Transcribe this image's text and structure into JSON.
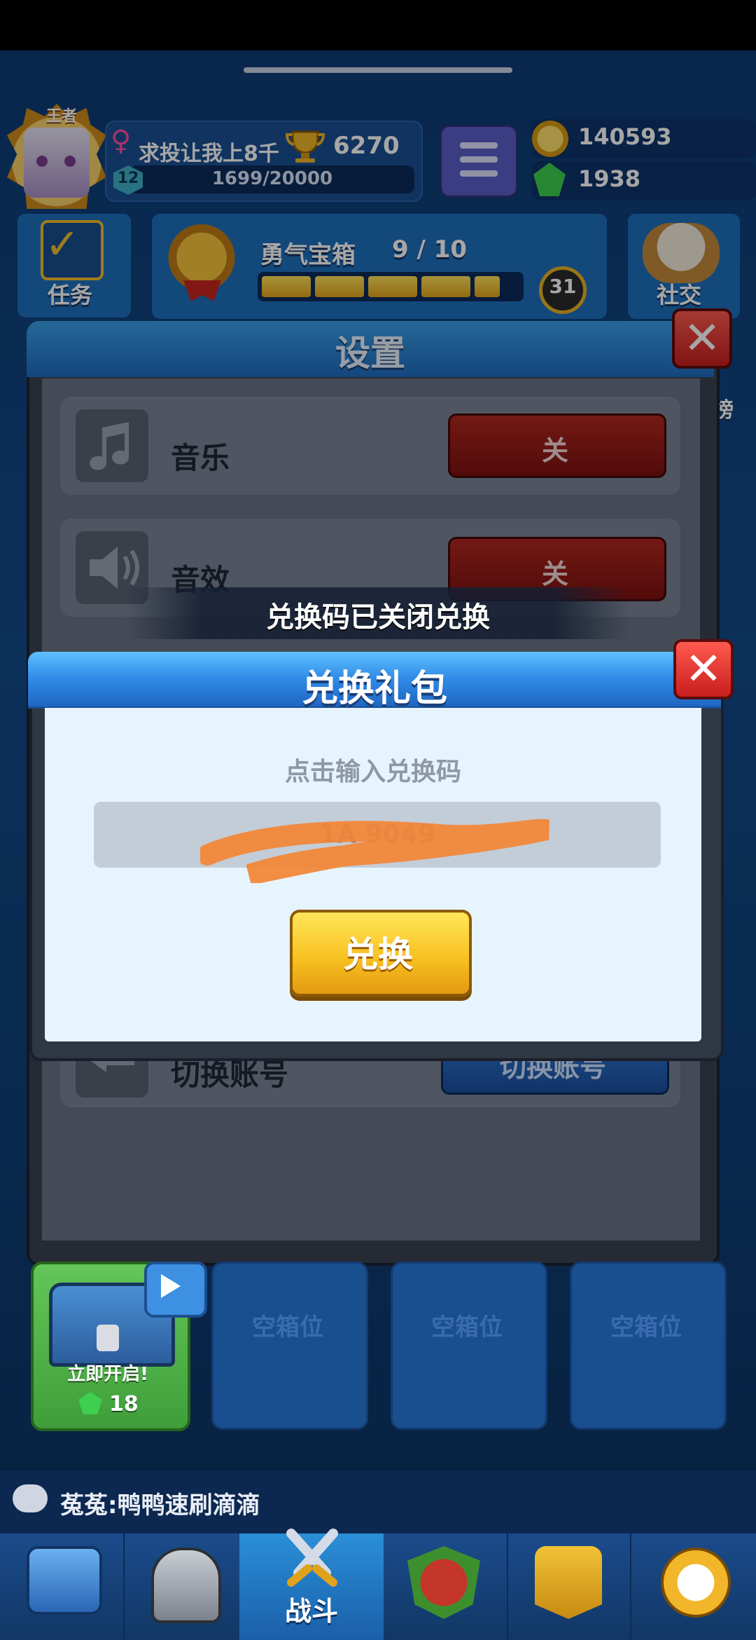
{
  "header": {
    "crown_label": "王者",
    "player_name": "求投让我上8千",
    "trophies": "6270",
    "level": "12",
    "xp": "1699/20000",
    "coins": "140593",
    "gems": "1938"
  },
  "cards": {
    "task_label": "任务",
    "chest_title": "勇气宝箱",
    "chest_progress": "9 / 10",
    "chest_progress_value": 0.9,
    "chest_count": "31",
    "social_label": "社交",
    "side_badge": "榜"
  },
  "settings": {
    "title": "设置",
    "rows": [
      {
        "label": "音乐",
        "button": "关",
        "icon": "music-note-icon"
      },
      {
        "label": "音效",
        "button": "关",
        "icon": "speaker-icon"
      },
      {
        "label": "切换账号",
        "button": "切换账号",
        "icon": "switch-account-icon"
      }
    ]
  },
  "toast": {
    "message": "兑换码已关闭兑换"
  },
  "gift_dialog": {
    "title": "兑换礼包",
    "hint": "点击输入兑换码",
    "code_value": "1A                    9049",
    "redeem_label": "兑换"
  },
  "chest_slots": {
    "active": {
      "open_label": "立即开启!",
      "gem_cost": "18"
    },
    "empty_label": "空箱位"
  },
  "chat": {
    "message": "菟菟:鸭鸭速刷滴滴"
  },
  "nav": {
    "active_label": "战斗"
  },
  "colors": {
    "accent_yellow": "#f8c222",
    "close_red": "#c81e1e",
    "header_blue": "#2f8ae6"
  }
}
